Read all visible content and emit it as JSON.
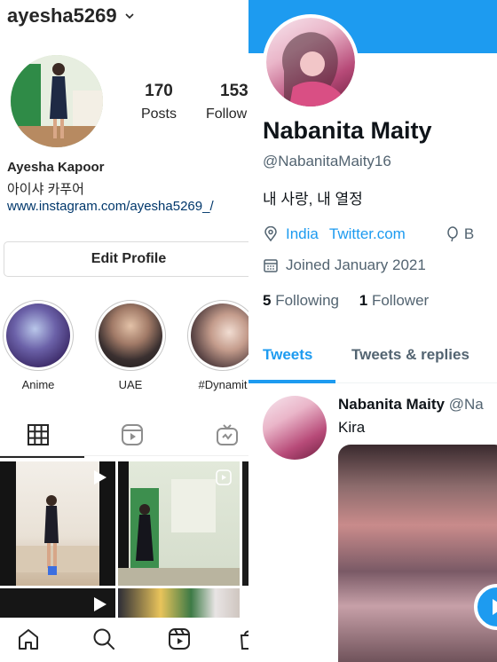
{
  "instagram": {
    "username": "ayesha5269",
    "stats": [
      {
        "value": "170",
        "label": "Posts"
      },
      {
        "value": "153",
        "label": "Follow"
      }
    ],
    "full_name": "Ayesha Kapoor",
    "bio": "아이샤 카푸어",
    "link": "www.instagram.com/ayesha5269_/",
    "edit_profile_label": "Edit Profile",
    "highlights": [
      {
        "label": "Anime"
      },
      {
        "label": "UAE"
      },
      {
        "label": "#Dynamit"
      }
    ],
    "tabs": [
      "grid-icon",
      "reels-icon",
      "igtv-icon"
    ],
    "bottom_nav": [
      "home-icon",
      "search-icon",
      "reels-icon",
      "shop-icon"
    ]
  },
  "twitter": {
    "name": "Nabanita Maity",
    "handle": "@NabanitaMaity16",
    "bio": "내 사랑, 내 열정",
    "location": "India",
    "website": "Twitter.com",
    "born_prefix": "B",
    "joined": "Joined January 2021",
    "following_count": "5",
    "following_label": "Following",
    "followers_count": "1",
    "followers_label": "Follower",
    "tabs": [
      "Tweets",
      "Tweets & replies"
    ],
    "tweet": {
      "name": "Nabanita Maity",
      "handle": "@Na",
      "text": "Kira"
    },
    "accent_color": "#1d9bf0"
  }
}
